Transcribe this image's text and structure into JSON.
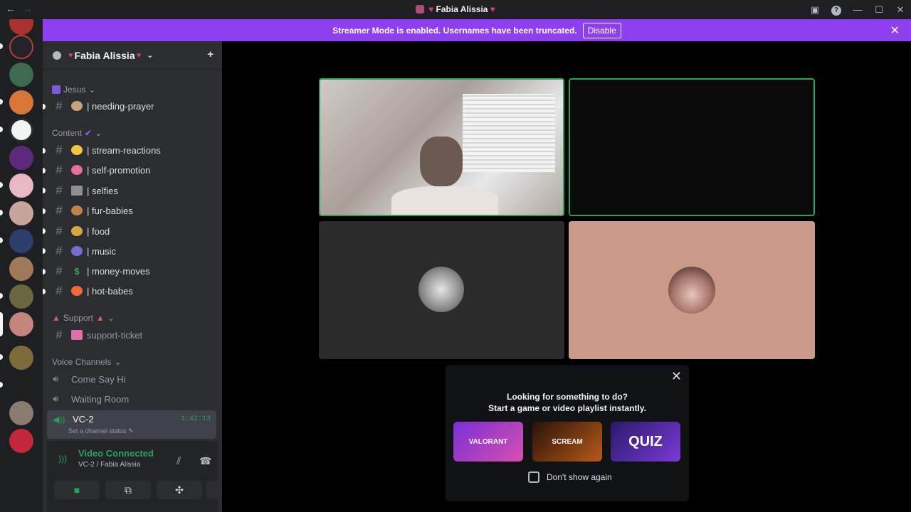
{
  "window": {
    "title": "Fabia Alissia",
    "back": "←",
    "forward": "→",
    "help": "?",
    "minimize": "—",
    "maximize": "☐",
    "close": "✕"
  },
  "banner": {
    "text": "Streamer Mode is enabled. Usernames have been truncated.",
    "button": "Disable",
    "close": "✕"
  },
  "server": {
    "name": "Fabia Alissia",
    "chevron": "⌄",
    "invite_icon": "+"
  },
  "categories": [
    {
      "label": "Jesus",
      "chevron": "⌄"
    },
    {
      "label": "Content",
      "chevron": "⌄"
    },
    {
      "label": "Support",
      "chevron": "⌄"
    },
    {
      "label": "Voice Channels",
      "chevron": "⌄"
    }
  ],
  "channels": [
    {
      "name": "| needing-prayer",
      "emoji_color": "#c9a27a"
    },
    {
      "name": "| stream-reactions",
      "emoji_color": "#f4c542"
    },
    {
      "name": "| self-promotion",
      "emoji_color": "#e76fa0"
    },
    {
      "name": "| selfies",
      "emoji_color": "#8c8f96"
    },
    {
      "name": "| fur-babies",
      "emoji_color": "#c2834a"
    },
    {
      "name": "| food",
      "emoji_color": "#d9a441"
    },
    {
      "name": "| music",
      "emoji_color": "#7a6bd0"
    },
    {
      "name": "| money-moves",
      "emoji_color": "#3ba55d"
    },
    {
      "name": "| hot-babes",
      "emoji_color": "#f0683c"
    },
    {
      "name": "support-ticket",
      "emoji_color": "#e06ea8"
    }
  ],
  "hash_symbol": "#",
  "voice_channels": [
    {
      "name": "Come Say Hi"
    },
    {
      "name": "Waiting Room"
    }
  ],
  "active_voice": {
    "name": "VC-2",
    "timer": "1:42:13",
    "status": "Set a channel status"
  },
  "rtc": {
    "status": "Video Connected",
    "location": "VC-2 / Fabia Alissia",
    "buttons": [
      "camera",
      "screen-share",
      "activities",
      "soundboard"
    ]
  },
  "popup": {
    "line1": "Looking for something to do?",
    "line2": "Start a game or video playlist instantly.",
    "games": [
      {
        "label": "VALORANT",
        "color": "#b23bd6"
      },
      {
        "label": "SCREAM",
        "color": "#7a3a12"
      },
      {
        "label": "QUIZ",
        "color": "#3a1f8a"
      }
    ],
    "dont_show": "Don't show again",
    "close": "✕"
  },
  "colors": {
    "accent": "#8e3ff0",
    "connected": "#23a55a"
  }
}
